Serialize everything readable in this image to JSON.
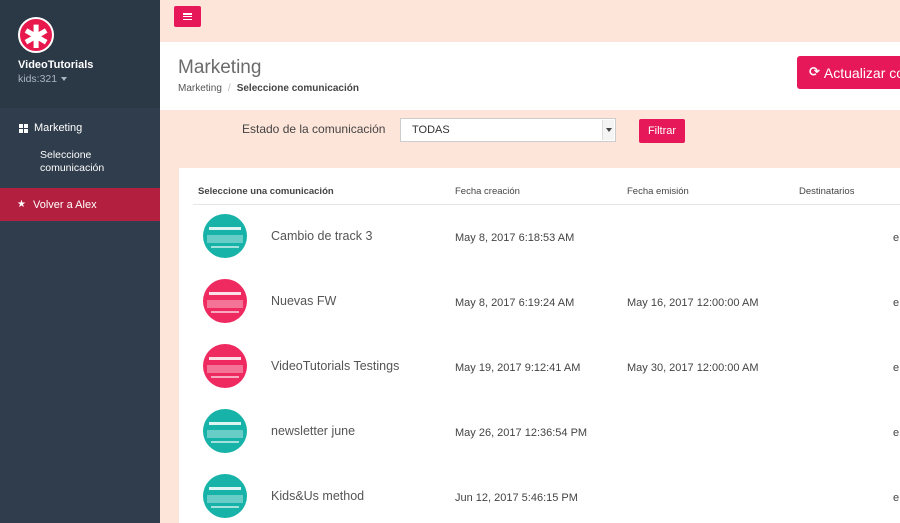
{
  "sidebar": {
    "brand": "VideoTutorials",
    "user": "kids:321",
    "nav_marketing": "Marketing",
    "nav_sub": "Seleccione comunicación",
    "nav_back": "Volver a Alex"
  },
  "header": {
    "title": "Marketing",
    "breadcrumb_root": "Marketing",
    "breadcrumb_current": "Seleccione comunicación",
    "update_button": "Actualizar co"
  },
  "filter": {
    "label": "Estado de la comunicación",
    "selected": "TODAS",
    "button": "Filtrar"
  },
  "table": {
    "headers": {
      "name": "Seleccione una comunicación",
      "created": "Fecha creación",
      "emitted": "Fecha emisión",
      "recipients": "Destinatarios"
    },
    "rows": [
      {
        "name": "Cambio de track 3",
        "created": "May 8, 2017 6:18:53 AM",
        "emitted": "",
        "edge": "e",
        "thumb": "teal"
      },
      {
        "name": "Nuevas FW",
        "created": "May 8, 2017 6:19:24 AM",
        "emitted": "May 16, 2017 12:00:00 AM",
        "edge": "e",
        "thumb": "pink"
      },
      {
        "name": "VideoTutorials Testings",
        "created": "May 19, 2017 9:12:41 AM",
        "emitted": "May 30, 2017 12:00:00 AM",
        "edge": "e",
        "thumb": "pink"
      },
      {
        "name": "newsletter june",
        "created": "May 26, 2017 12:36:54 PM",
        "emitted": "",
        "edge": "e",
        "thumb": "teal"
      },
      {
        "name": "Kids&Us method",
        "created": "Jun 12, 2017 5:46:15 PM",
        "emitted": "",
        "edge": "e",
        "thumb": "teal"
      }
    ]
  },
  "colors": {
    "accent": "#e6185a",
    "sidebar": "#2f3d4c",
    "background": "#fde5d9"
  }
}
